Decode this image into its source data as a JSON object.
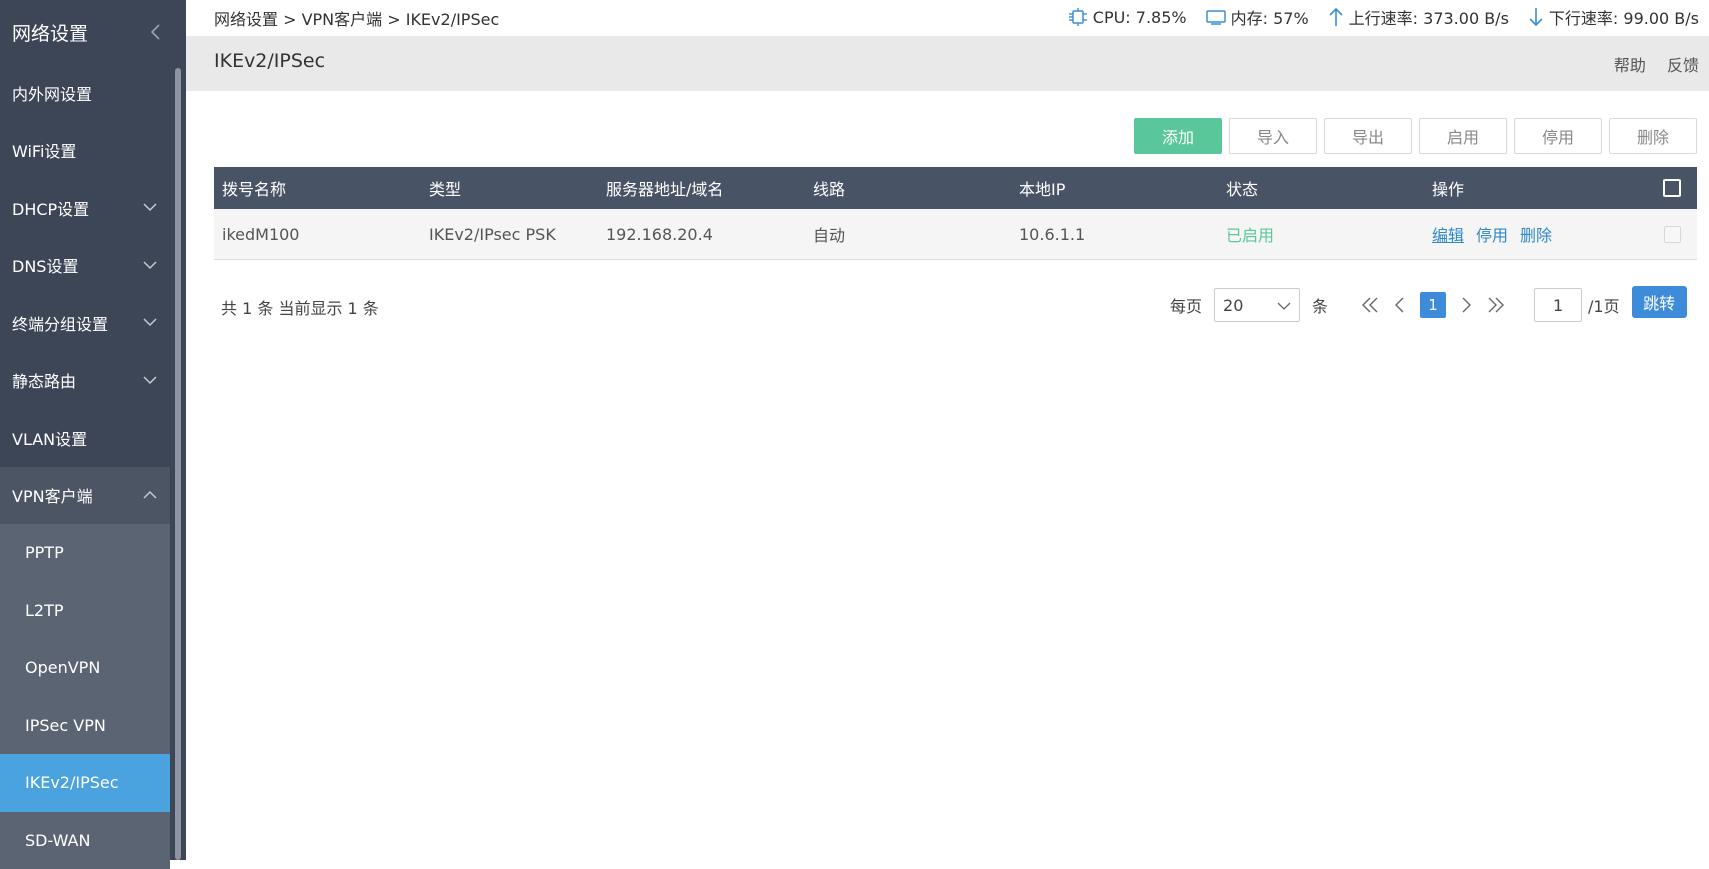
{
  "sidebar": {
    "title": "网络设置",
    "items": [
      {
        "label": "内外网设置"
      },
      {
        "label": "WiFi设置"
      },
      {
        "label": "DHCP设置"
      },
      {
        "label": "DNS设置"
      },
      {
        "label": "终端分组设置"
      },
      {
        "label": "静态路由"
      },
      {
        "label": "VLAN设置"
      },
      {
        "label": "VPN客户端"
      }
    ],
    "sub_items": [
      {
        "label": "PPTP"
      },
      {
        "label": "L2TP"
      },
      {
        "label": "OpenVPN"
      },
      {
        "label": "IPSec VPN"
      },
      {
        "label": "IKEv2/IPSec"
      },
      {
        "label": "SD-WAN"
      }
    ]
  },
  "topbar": {
    "breadcrumb": "网络设置 > VPN客户端 > IKEv2/IPSec",
    "cpu": "CPU: 7.85%",
    "memory": "内存: 57%",
    "upload": "上行速率: 373.00 B/s",
    "download": "下行速率: 99.00 B/s"
  },
  "header": {
    "title": "IKEv2/IPSec",
    "help": "帮助",
    "feedback": "反馈"
  },
  "toolbar": {
    "add": "添加",
    "import": "导入",
    "export": "导出",
    "enable": "启用",
    "disable": "停用",
    "delete": "删除"
  },
  "table": {
    "headers": [
      "拨号名称",
      "类型",
      "服务器地址/域名",
      "线路",
      "本地IP",
      "状态",
      "操作"
    ],
    "rows": [
      {
        "name": "ikedM100",
        "type": "IKEv2/IPsec PSK",
        "server": "192.168.20.4",
        "line": "自动",
        "local_ip": "10.6.1.1",
        "status": "已启用",
        "op_edit": "编辑",
        "op_disable": "停用",
        "op_delete": "删除"
      }
    ]
  },
  "pagination": {
    "summary": "共 1 条 当前显示 1 条",
    "per_page_label": "每页",
    "per_page_value": "20",
    "unit": "条",
    "current_page": "1",
    "jump_value": "1",
    "total_pages": "/1页",
    "jump_button": "跳转"
  },
  "colors": {
    "sidebar_bg": "#3d4657",
    "active_item": "#4aa3df",
    "primary_green": "#5ac79b",
    "table_header": "#495366",
    "link_blue": "#2f88c8",
    "page_blue": "#3d8bd9"
  }
}
